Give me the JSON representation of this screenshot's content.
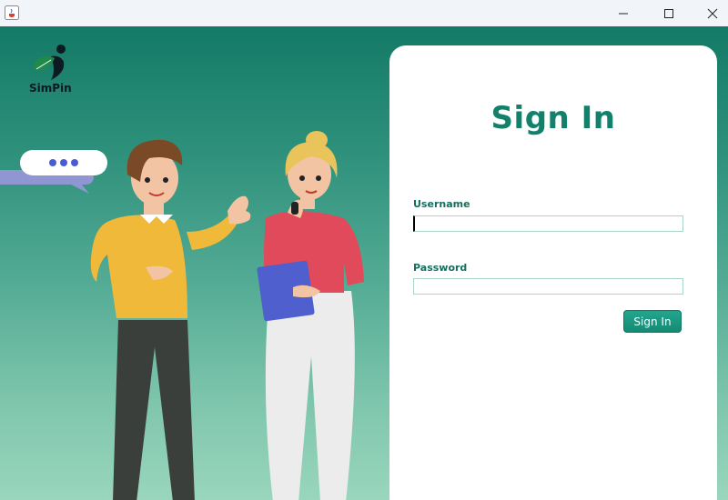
{
  "window": {
    "app_icon": "java-cup-icon",
    "controls": [
      "minimize-icon",
      "maximize-icon",
      "close-icon"
    ]
  },
  "branding": {
    "logo_text": "SimPin",
    "logo_icon": "person-leaf-icon"
  },
  "signin": {
    "title": "Sign In",
    "username_label": "Username",
    "username_value": "",
    "password_label": "Password",
    "password_value": "",
    "button_label": "Sign In"
  },
  "colors": {
    "accent": "#12806b",
    "gradient_top": "#137a67",
    "gradient_bottom": "#99d6bd",
    "button": "#1a9a82",
    "speech_bubble_dots": "#4a5bd4"
  }
}
